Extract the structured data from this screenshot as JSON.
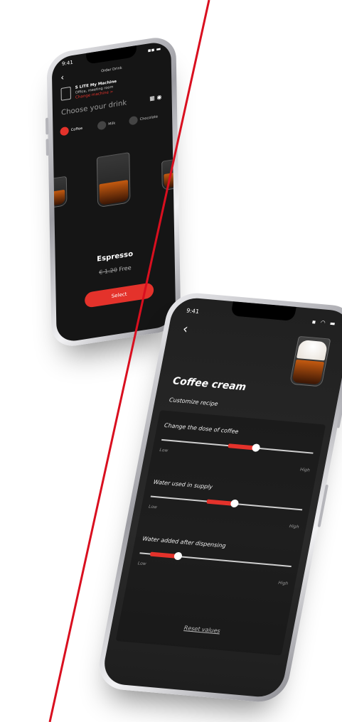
{
  "colors": {
    "accent": "#e4322b",
    "screen_bg": "#151515"
  },
  "phone1": {
    "time": "9:41",
    "title": "Order Drink",
    "machine": {
      "name": "S LITE My Machine",
      "location": "Office, meeting room",
      "change_link": "Change machine >"
    },
    "choose_label": "Choose your drink",
    "tabs": [
      {
        "label": "Coffee"
      },
      {
        "label": "Milk"
      },
      {
        "label": "Chocolate"
      }
    ],
    "drink_name": "Espresso",
    "price": "€ 1.20",
    "price_note": "Free",
    "select_label": "Select"
  },
  "phone2": {
    "time": "9:41",
    "title": "Coffee cream",
    "subtitle": "Customize recipe",
    "sliders": [
      {
        "label": "Change the dose of coffee",
        "low": "Low",
        "high": "High",
        "level": 0.62
      },
      {
        "label": "Water used in supply",
        "low": "Low",
        "high": "High",
        "level": 0.55
      },
      {
        "label": "Water added after dispensing",
        "low": "Low",
        "high": "High",
        "level": 0.25
      }
    ],
    "reset_label": "Reset values"
  }
}
